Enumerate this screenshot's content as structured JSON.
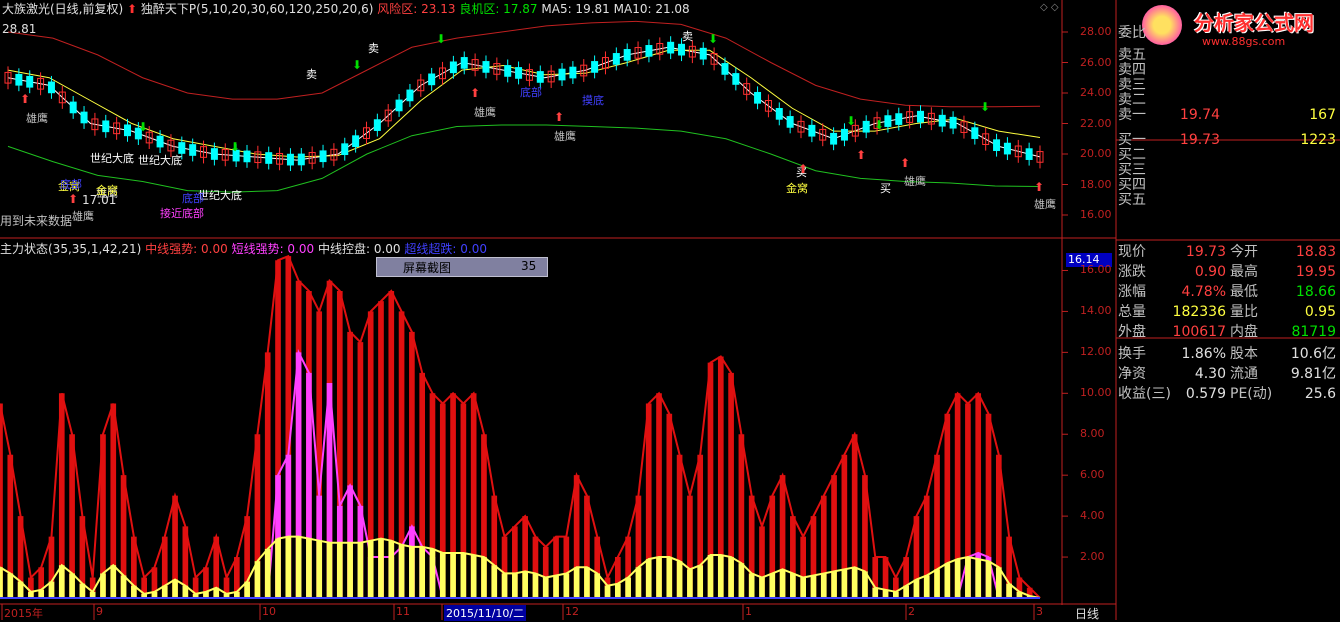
{
  "header": {
    "stock": "大族激光(日线,前复权)",
    "indicator": "独醉天下P(5,10,20,30,60,120,250,20,6)",
    "risk_label": "风险区: 23.13",
    "opp_label": "良机区: 17.87",
    "ma5": "MA5: 19.81",
    "ma10": "MA10: 21.08"
  },
  "watermark": {
    "text": "分析家公式网",
    "url": "www.88gs.com"
  },
  "main_chart": {
    "note": "用到未来数据",
    "low_label": "17.01",
    "top_left_value": "28.81",
    "y_ticks": [
      "28.00",
      "26.00",
      "24.00",
      "22.00",
      "20.00",
      "18.00",
      "16.00"
    ],
    "annotations": [
      "雄鹰",
      "雄鹰",
      "雄鹰",
      "雄鹰",
      "雄鹰",
      "雄鹰",
      "雄鹰",
      "世纪大底",
      "世纪大底",
      "世纪大底",
      "金窝",
      "金窝",
      "金窝",
      "买",
      "买",
      "卖",
      "卖",
      "卖",
      "接近底部",
      "底部",
      "底部",
      "底部",
      "摸底"
    ]
  },
  "indicator_chart": {
    "title": "主力状态(35,35,1,42,21)",
    "mid_strong": "中线强势: 0.00",
    "short_strong": "短线强势: 0.00",
    "mid_control": "中线控盘: 0.00",
    "ultra_rebound": "超线超跌: 0.00",
    "screenshot_label": "屏幕截图",
    "screenshot_value": "35",
    "current_value": "16.14",
    "y_ticks": [
      "16.00",
      "14.00",
      "12.00",
      "10.00",
      "8.00",
      "6.00",
      "4.00",
      "2.00"
    ]
  },
  "x_axis": {
    "labels": [
      "2015年",
      "9",
      "10",
      "11",
      "2015/11/10/二",
      "12",
      "1",
      "2",
      "3"
    ],
    "period": "日线"
  },
  "order_book": {
    "sells": [
      {
        "label": "卖五",
        "price": "",
        "vol": ""
      },
      {
        "label": "卖四",
        "price": "",
        "vol": ""
      },
      {
        "label": "卖三",
        "price": "",
        "vol": ""
      },
      {
        "label": "卖二",
        "price": "",
        "vol": ""
      },
      {
        "label": "卖一",
        "price": "19.74",
        "vol": "167"
      }
    ],
    "buys": [
      {
        "label": "买一",
        "price": "19.73",
        "vol": "1223"
      },
      {
        "label": "买二",
        "price": "",
        "vol": ""
      },
      {
        "label": "买三",
        "price": "",
        "vol": ""
      },
      {
        "label": "买四",
        "price": "",
        "vol": ""
      },
      {
        "label": "买五",
        "price": "",
        "vol": ""
      }
    ],
    "header_label": "委比"
  },
  "stats": [
    {
      "l1": "现价",
      "v1": "19.73",
      "l2": "今开",
      "v2": "18.83",
      "c1": "red",
      "c2": "red"
    },
    {
      "l1": "涨跌",
      "v1": "0.90",
      "l2": "最高",
      "v2": "19.95",
      "c1": "red",
      "c2": "red"
    },
    {
      "l1": "涨幅",
      "v1": "4.78%",
      "l2": "最低",
      "v2": "18.66",
      "c1": "red",
      "c2": "green"
    },
    {
      "l1": "总量",
      "v1": "182336",
      "l2": "量比",
      "v2": "0.95",
      "c1": "yellow",
      "c2": "yellow"
    },
    {
      "l1": "外盘",
      "v1": "100617",
      "l2": "内盘",
      "v2": "81719",
      "c1": "red",
      "c2": "green"
    },
    {
      "l1": "换手",
      "v1": "1.86%",
      "l2": "股本",
      "v2": "10.6亿",
      "c1": "white",
      "c2": "white"
    },
    {
      "l1": "净资",
      "v1": "4.30",
      "l2": "流通",
      "v2": "9.81亿",
      "c1": "white",
      "c2": "white"
    },
    {
      "l1": "收益(三)",
      "v1": "0.579",
      "l2": "PE(动)",
      "v2": "25.6",
      "c1": "white",
      "c2": "white"
    }
  ],
  "colors": {
    "risk": "#ff4040",
    "opp": "#00e000",
    "ma5": "#ffffff",
    "ma10": "#ffff40",
    "red_bar": "#e01010",
    "magenta_bar": "#ff40ff",
    "yellow_bar": "#ffff60",
    "upper_band": "#c02020",
    "lower_band": "#20c020",
    "candle_up": "#ff3030",
    "candle_down": "#00ffff"
  },
  "chart_data": [
    {
      "type": "line",
      "title": "",
      "x_range": [
        "2015-08",
        "2016-03"
      ],
      "ylim": [
        16,
        28
      ],
      "series": [
        {
          "name": "MA5",
          "values": [
            25.0,
            24.5,
            22.0,
            21.5,
            20.5,
            20.0,
            19.8,
            19.6,
            20.0,
            22.0,
            24.5,
            26.0,
            25.5,
            25.0,
            25.5,
            26.5,
            27.0,
            26.5,
            24.0,
            22.0,
            21.0,
            22.0,
            22.5,
            22.0,
            20.5,
            19.81
          ]
        },
        {
          "name": "MA10",
          "values": [
            25.5,
            25.0,
            23.5,
            22.0,
            21.0,
            20.5,
            20.0,
            19.8,
            19.9,
            21.0,
            23.5,
            25.5,
            25.8,
            25.2,
            25.3,
            26.0,
            26.8,
            26.8,
            25.0,
            23.0,
            21.5,
            21.5,
            22.0,
            22.3,
            21.5,
            21.08
          ]
        }
      ]
    },
    {
      "type": "bar",
      "title": "",
      "ylim": [
        0,
        17
      ],
      "series": [
        {
          "name": "中线强势",
          "values": [
            9.5,
            7,
            4,
            1,
            1.5,
            3,
            10,
            8,
            4,
            1,
            8,
            9.5,
            6,
            3,
            1,
            1.5,
            3,
            5,
            3.5,
            1,
            1.5,
            3,
            1,
            2,
            4,
            8,
            12,
            16.5,
            16.7,
            15.5,
            15,
            14,
            15.5,
            15,
            13,
            12.5,
            14,
            14.5,
            15,
            14,
            13,
            11,
            10,
            9.5,
            10,
            9.5,
            10,
            8,
            5,
            3,
            3.5,
            4,
            3,
            2.5,
            3,
            3,
            6,
            5,
            3,
            1,
            2,
            3,
            5,
            9.5,
            10,
            9,
            7,
            5,
            7,
            11.5,
            11.8,
            11,
            8,
            5,
            3.5,
            5,
            6,
            4,
            3,
            4,
            5,
            6,
            7,
            8,
            6,
            2,
            2,
            1,
            2,
            4,
            5,
            7,
            9,
            10,
            9.5,
            10,
            9,
            7,
            3,
            1,
            0.5,
            0
          ]
        },
        {
          "name": "短线强势",
          "values": [
            0,
            0,
            0,
            0,
            0,
            0,
            0,
            0,
            0,
            0,
            0,
            0,
            0,
            0,
            0,
            0,
            0,
            0,
            0,
            0,
            0,
            0,
            0,
            0,
            0,
            0,
            0,
            6,
            7,
            12,
            11,
            5,
            10.5,
            4.5,
            5.5,
            4.5,
            2,
            2,
            2,
            2.5,
            3.5,
            2.5,
            2,
            0,
            0,
            0,
            0,
            0,
            0,
            0,
            0,
            0,
            0,
            0,
            0,
            0,
            0,
            0,
            0,
            0,
            0,
            0,
            0,
            0,
            0,
            0,
            0,
            0,
            0,
            0,
            0,
            0,
            0,
            0,
            0,
            0,
            0,
            0,
            0,
            0,
            0,
            0,
            0,
            0,
            0,
            0,
            0,
            0,
            0,
            0,
            0,
            0,
            0,
            0,
            2,
            2.2,
            2,
            0,
            0,
            0,
            0,
            0
          ]
        },
        {
          "name": "中线控盘",
          "values": [
            1.5,
            1.2,
            0.8,
            0.3,
            0.4,
            0.8,
            1.6,
            1.2,
            0.7,
            0.3,
            1.2,
            1.6,
            1.1,
            0.6,
            0.2,
            0.3,
            0.6,
            0.9,
            0.6,
            0.2,
            0.3,
            0.5,
            0.2,
            0.3,
            0.8,
            1.8,
            2.4,
            2.9,
            3.0,
            3.0,
            2.9,
            2.8,
            2.7,
            2.7,
            2.7,
            2.7,
            2.8,
            2.9,
            2.8,
            2.6,
            2.5,
            2.5,
            2.4,
            2.2,
            2.2,
            2.2,
            2.1,
            2.0,
            1.6,
            1.2,
            1.2,
            1.3,
            1.2,
            1.0,
            1.1,
            1.2,
            1.5,
            1.5,
            1.2,
            0.6,
            0.7,
            1.0,
            1.5,
            1.9,
            2.0,
            2.0,
            1.8,
            1.4,
            1.6,
            2.1,
            2.1,
            2.0,
            1.7,
            1.2,
            1.0,
            1.2,
            1.4,
            1.2,
            1.0,
            1.1,
            1.2,
            1.3,
            1.4,
            1.5,
            1.3,
            0.5,
            0.4,
            0.3,
            0.6,
            0.9,
            1.1,
            1.4,
            1.7,
            1.9,
            2.0,
            1.9,
            1.8,
            1.5,
            0.7,
            0.3,
            0.1,
            0
          ]
        }
      ]
    }
  ]
}
